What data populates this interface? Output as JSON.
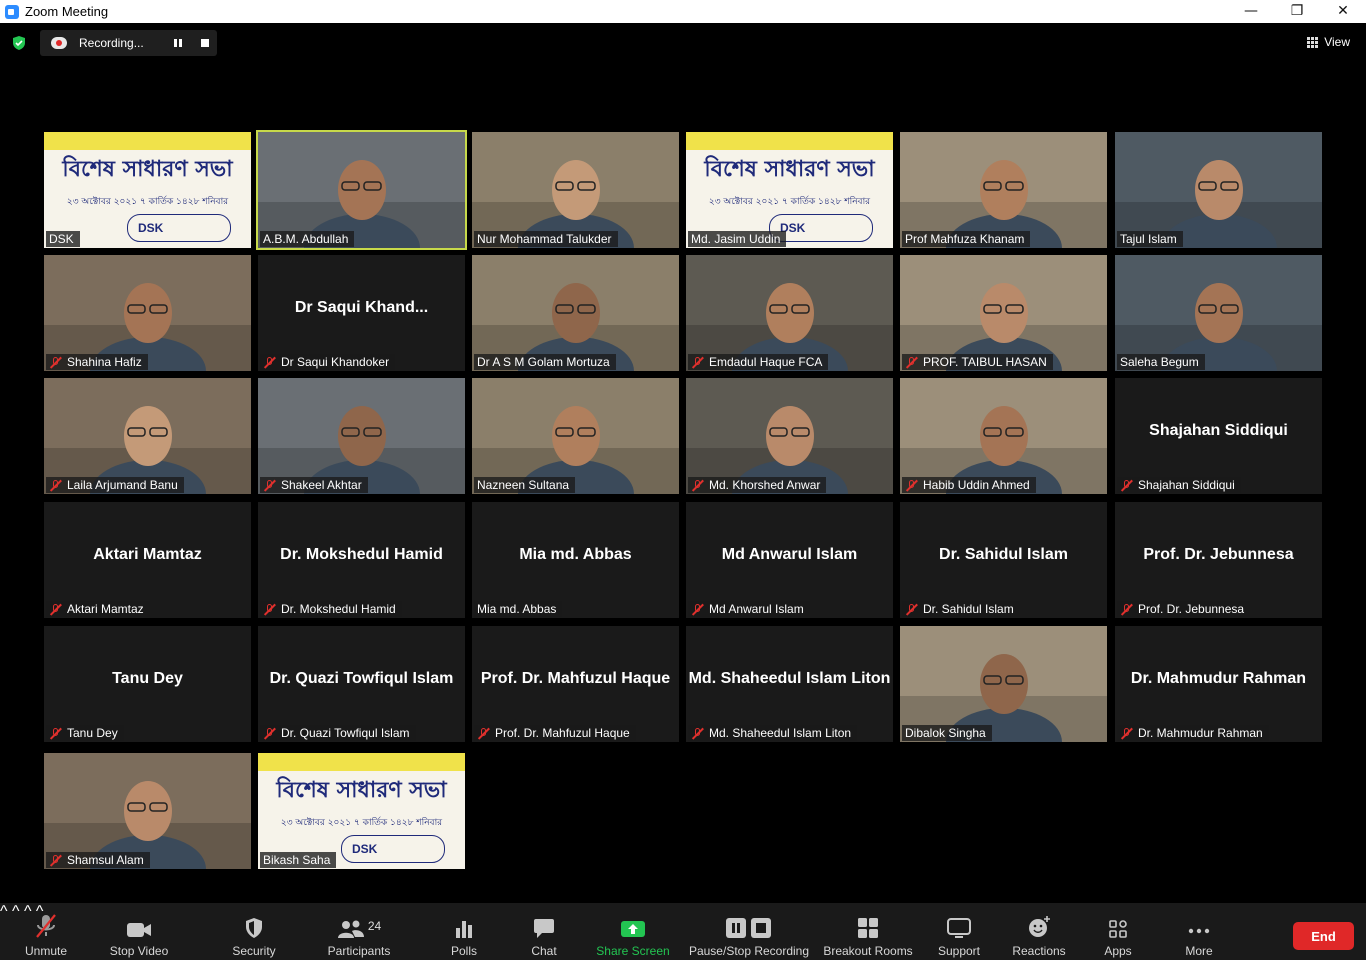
{
  "window": {
    "title": "Zoom Meeting",
    "minimize": "—",
    "maximize": "❐",
    "close": "✕"
  },
  "recording": {
    "label": "Recording..."
  },
  "view_button": {
    "label": "View"
  },
  "banner": {
    "line1": "বিশেষ সাধারণ সভা",
    "line2": "২৩ অক্টোবর ২০২১  ৭ কার্তিক ১৪২৮  শনিবার",
    "logo": "DSK"
  },
  "participants": [
    {
      "tag": "DSK",
      "muted": false,
      "video": "banner",
      "center": ""
    },
    {
      "tag": "A.B.M. Abdullah",
      "muted": false,
      "video": "camera",
      "active": true,
      "center": ""
    },
    {
      "tag": "Nur Mohammad Talukder",
      "muted": false,
      "video": "camera",
      "center": ""
    },
    {
      "tag": "Md. Jasim Uddin",
      "muted": false,
      "video": "banner",
      "center": ""
    },
    {
      "tag": "Prof Mahfuza Khanam",
      "muted": false,
      "video": "camera",
      "center": ""
    },
    {
      "tag": "Tajul Islam",
      "muted": false,
      "video": "camera",
      "center": ""
    },
    {
      "tag": "Shahina Hafiz",
      "muted": true,
      "video": "camera",
      "center": ""
    },
    {
      "tag": "Dr Saqui Khandoker",
      "muted": true,
      "video": "none",
      "center": "Dr  Saqui  Khand..."
    },
    {
      "tag": "Dr A S M Golam Mortuza",
      "muted": false,
      "video": "camera",
      "center": ""
    },
    {
      "tag": "Emdadul  Haque FCA",
      "muted": true,
      "video": "camera",
      "center": ""
    },
    {
      "tag": "PROF. TAIBUL HASAN",
      "muted": true,
      "video": "camera",
      "center": ""
    },
    {
      "tag": "Saleha Begum",
      "muted": false,
      "video": "camera",
      "center": ""
    },
    {
      "tag": "Laila Arjumand Banu",
      "muted": true,
      "video": "camera",
      "center": ""
    },
    {
      "tag": "Shakeel Akhtar",
      "muted": true,
      "video": "camera",
      "center": ""
    },
    {
      "tag": "Nazneen Sultana",
      "muted": false,
      "video": "camera",
      "center": ""
    },
    {
      "tag": "Md. Khorshed Anwar",
      "muted": true,
      "video": "camera",
      "center": ""
    },
    {
      "tag": "Habib Uddin Ahmed",
      "muted": true,
      "video": "camera",
      "center": ""
    },
    {
      "tag": "Shajahan Siddiqui",
      "muted": true,
      "video": "none",
      "center": "Shajahan Siddiqui"
    },
    {
      "tag": "Aktari Mamtaz",
      "muted": true,
      "video": "none",
      "center": "Aktari Mamtaz"
    },
    {
      "tag": "Dr. Mokshedul Hamid",
      "muted": true,
      "video": "none",
      "center": "Dr. Mokshedul Hamid"
    },
    {
      "tag": "Mia md. Abbas",
      "muted": false,
      "video": "none",
      "center": "Mia md. Abbas"
    },
    {
      "tag": "Md Anwarul Islam",
      "muted": true,
      "video": "none",
      "center": "Md Anwarul Islam"
    },
    {
      "tag": "Dr. Sahidul Islam",
      "muted": true,
      "video": "none",
      "center": "Dr. Sahidul Islam"
    },
    {
      "tag": "Prof. Dr. Jebunnesa",
      "muted": true,
      "video": "none",
      "center": "Prof. Dr. Jebunnesa"
    },
    {
      "tag": "Tanu Dey",
      "muted": true,
      "video": "none",
      "center": "Tanu Dey"
    },
    {
      "tag": "Dr. Quazi Towfiqul Islam",
      "muted": true,
      "video": "none",
      "center": "Dr. Quazi Towfiqul Islam"
    },
    {
      "tag": "Prof. Dr. Mahfuzul Haque",
      "muted": true,
      "video": "none",
      "center": "Prof. Dr. Mahfuzul Haque"
    },
    {
      "tag": "Md. Shaheedul Islam Liton",
      "muted": true,
      "video": "none",
      "center": "Md. Shaheedul Islam Liton"
    },
    {
      "tag": "Dibalok Singha",
      "muted": false,
      "video": "camera",
      "center": ""
    },
    {
      "tag": "Dr. Mahmudur Rahman",
      "muted": true,
      "video": "none",
      "center": "Dr. Mahmudur Rahman"
    },
    {
      "tag": "Shamsul Alam",
      "muted": true,
      "video": "camera",
      "center": ""
    },
    {
      "tag": "Bikash Saha",
      "muted": false,
      "video": "banner",
      "center": ""
    }
  ],
  "toolbar": {
    "unmute": "Unmute",
    "stop_video": "Stop Video",
    "security": "Security",
    "participants": "Participants",
    "participants_count": "24",
    "polls": "Polls",
    "chat": "Chat",
    "share_screen": "Share Screen",
    "pause_stop_recording": "Pause/Stop Recording",
    "breakout_rooms": "Breakout Rooms",
    "support": "Support",
    "reactions": "Reactions",
    "apps": "Apps",
    "more": "More",
    "end": "End"
  },
  "colors": {
    "active_speaker": "#c7d94a",
    "share_green": "#23c552",
    "end_red": "#e02828",
    "mute_red": "#e0302d"
  }
}
